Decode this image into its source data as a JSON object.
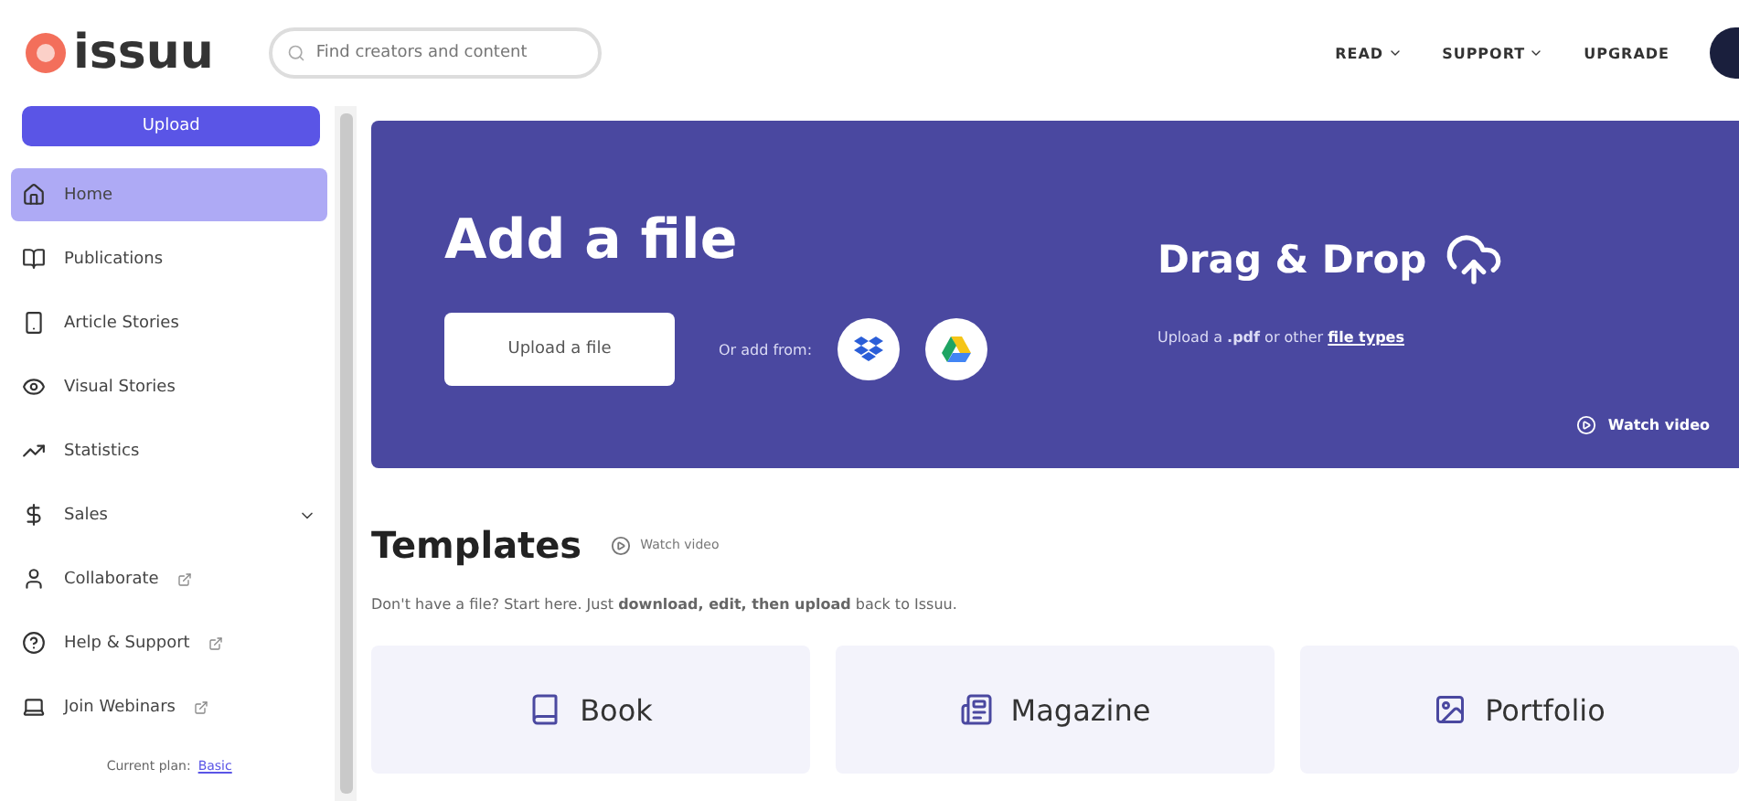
{
  "header": {
    "logo": "issuu",
    "search": {
      "placeholder": "Find creators and content"
    },
    "nav": [
      {
        "label": "READ",
        "dropdown": true
      },
      {
        "label": "SUPPORT",
        "dropdown": true
      },
      {
        "label": "UPGRADE",
        "dropdown": false
      }
    ]
  },
  "sidebar": {
    "upload_button": "Upload",
    "items": [
      {
        "label": "Home",
        "kind": "home",
        "selected": true,
        "external": false,
        "expandable": false
      },
      {
        "label": "Publications",
        "kind": "book",
        "selected": false,
        "external": false,
        "expandable": false
      },
      {
        "label": "Article Stories",
        "kind": "phone",
        "selected": false,
        "external": false,
        "expandable": false
      },
      {
        "label": "Visual Stories",
        "kind": "eye",
        "selected": false,
        "external": false,
        "expandable": false
      },
      {
        "label": "Statistics",
        "kind": "chart",
        "selected": false,
        "external": false,
        "expandable": false
      },
      {
        "label": "Sales",
        "kind": "dollar",
        "selected": false,
        "external": false,
        "expandable": true
      },
      {
        "label": "Collaborate",
        "kind": "user",
        "selected": false,
        "external": true,
        "expandable": false
      },
      {
        "label": "Help & Support",
        "kind": "help",
        "selected": false,
        "external": true,
        "expandable": false
      },
      {
        "label": "Join Webinars",
        "kind": "laptop",
        "selected": false,
        "external": true,
        "expandable": false
      }
    ],
    "plan_label": "Current plan:",
    "plan_link": "Basic"
  },
  "banner": {
    "title": "Add a file",
    "upload_button": "Upload a file",
    "add_from": "Or add from:",
    "drag_title": "Drag & Drop",
    "drag_hint": "Upload a **.pdf** or other",
    "drag_link": "file types",
    "watch_video": "Watch video"
  },
  "templates": {
    "title": "Templates",
    "watch_video": "Watch video",
    "description": "Don't have a file? Start here. Just **download, edit, then upload** back to Issuu.",
    "cards": [
      {
        "label": "Book",
        "kind": "book"
      },
      {
        "label": "Magazine",
        "kind": "magazine"
      },
      {
        "label": "Portfolio",
        "kind": "portfolio"
      }
    ]
  }
}
